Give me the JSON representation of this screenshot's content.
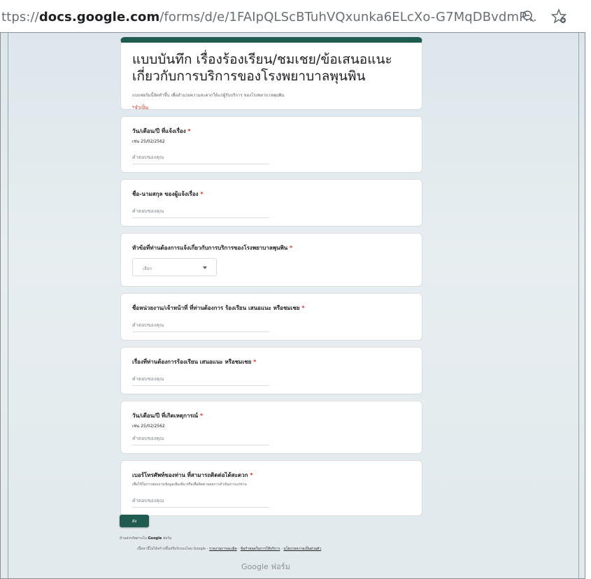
{
  "browser": {
    "url_prefix": "ttps://",
    "url_domain": "docs.google.com",
    "url_path": "/forms/d/e/1FAIpQLScBTuhVQxunka6ELcXo-G7MqDBvdmP..."
  },
  "form": {
    "title": "แบบบันทึก เรื่องร้องเรียน/ชมเชย/ข้อเสนอแนะ เกี่ยวกับการบริการของโรงพยาบาลพุนพิน",
    "description": "แบบฟอร์มนี้จัดทำขึ้น เพื่ออำนวยความสะดวกให้แก่ผู้รับบริการ ของโรงพยาบาลพุนพิน",
    "required_note": "*จำเป็น",
    "accent_color": "#1f5c4f",
    "questions": [
      {
        "label": "วัน/เดือน/ปี ที่แจ้งเรื่อง",
        "required": "*",
        "hint": "เช่น 25/02/2562",
        "answer_placeholder": "คำตอบของคุณ"
      },
      {
        "label": "ชื่อ-นามสกุล ของผู้แจ้งเรื่อง",
        "required": "*",
        "answer_placeholder": "คำตอบของคุณ"
      },
      {
        "label": "หัวข้อที่ท่านต้องการแจ้งเกี่ยวกับการบริการของโรงพยาบาลพุนพิน",
        "required": "*",
        "select_placeholder": "เลือก"
      },
      {
        "label": "ชื่อหน่วยงาน/เจ้าหน้าที่ ที่ท่านต้องการ ร้องเรียน เสนอแนะ หรือชมเชย",
        "required": "*",
        "answer_placeholder": "คำตอบของคุณ"
      },
      {
        "label": "เรื่องที่ท่านต้องการร้องเรียน เสนอแนะ หรือชมเชย",
        "required": "*",
        "answer_placeholder": "คำตอบของคุณ"
      },
      {
        "label": "วัน/เดือน/ปี ที่เกิดเหตุการณ์",
        "required": "*",
        "hint": "เช่น 25/02/2562",
        "answer_placeholder": "คำตอบของคุณ"
      },
      {
        "label": "เบอร์โทรศัพท์ของท่าน ที่สามารถติดต่อได้สะดวก",
        "required": "*",
        "hint": "เพื่อใช้ในการสอบถามข้อมูลเพิ่มเติม หรือเพื่อติดตามผลการดำเนินการแก่ท่าน",
        "answer_placeholder": "คำตอบของคุณ"
      }
    ],
    "submit_label": "ส่ง",
    "footer_password": "ห้ามส่งรหัสผ่านใน",
    "footer_google": "Google",
    "footer_forms": "ฟอร์ม",
    "footer_disclaimer": "เนื้อหานี้ไม่ได้สร้างขึ้นหรือรับรองโดย Google",
    "footer_link_report": "รายงานการละเมิด",
    "footer_link_terms": "ข้อกำหนดในการให้บริการ",
    "footer_link_privacy": "นโยบายความเป็นส่วนตัว",
    "google_forms_brand": "Google ฟอร์ม"
  }
}
